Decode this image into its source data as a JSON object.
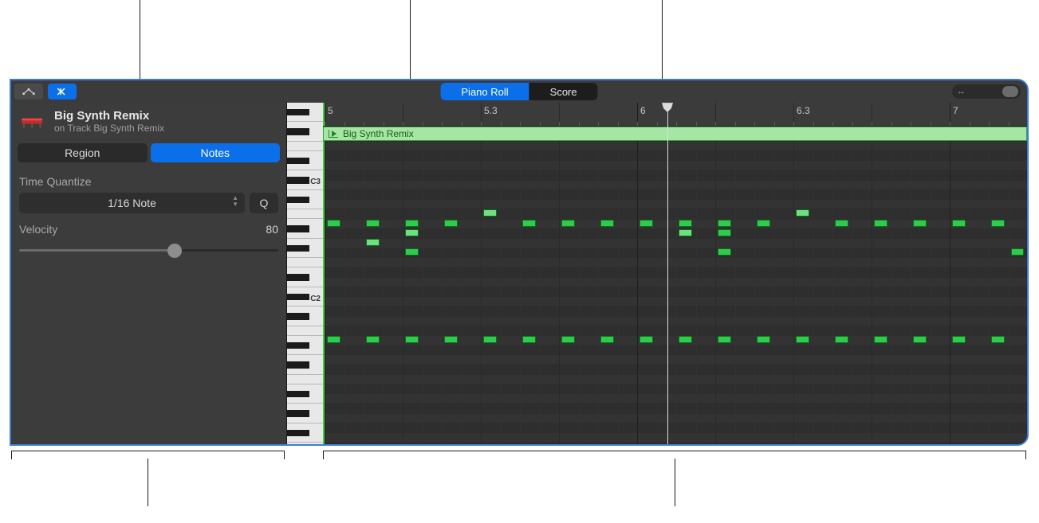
{
  "viewSwitcher": {
    "pianoRoll": "Piano Roll",
    "score": "Score"
  },
  "region": {
    "name": "Big Synth Remix",
    "subtitle": "on Track Big Synth Remix",
    "barLabel": "Big Synth Remix"
  },
  "inspectorTabs": {
    "region": "Region",
    "notes": "Notes"
  },
  "timeQuantize": {
    "label": "Time Quantize",
    "value": "1/16 Note",
    "qButton": "Q"
  },
  "velocity": {
    "label": "Velocity",
    "value": "80"
  },
  "ruler": {
    "ticks": [
      {
        "pos": 0,
        "label": "5",
        "maj": true
      },
      {
        "pos": 98,
        "label": ""
      },
      {
        "pos": 196,
        "label": "5.3"
      },
      {
        "pos": 294,
        "label": ""
      },
      {
        "pos": 392,
        "label": "6",
        "maj": true
      },
      {
        "pos": 490,
        "label": ""
      },
      {
        "pos": 588,
        "label": "6.3"
      },
      {
        "pos": 686,
        "label": ""
      },
      {
        "pos": 784,
        "label": "7",
        "maj": true
      }
    ]
  },
  "pianoKeys": {
    "labels": [
      {
        "text": "C3",
        "topPx": 94
      },
      {
        "text": "C2",
        "topPx": 241
      }
    ]
  },
  "playheadLeft": 432,
  "gridConfig": {
    "rowHeight": 12.2,
    "startTopOffset": 0,
    "beatWidth": 24.5,
    "barBeats": 16
  },
  "notes": [
    {
      "col": 0,
      "row": 8,
      "len": 1
    },
    {
      "col": 2,
      "row": 8,
      "len": 1
    },
    {
      "col": 4,
      "row": 8,
      "len": 1
    },
    {
      "col": 2,
      "row": 10,
      "len": 1,
      "light": true
    },
    {
      "col": 6,
      "row": 8,
      "len": 1
    },
    {
      "col": 8,
      "row": 7,
      "len": 1,
      "light": true
    },
    {
      "col": 10,
      "row": 8,
      "len": 1
    },
    {
      "col": 12,
      "row": 8,
      "len": 1
    },
    {
      "col": 14,
      "row": 8,
      "len": 1
    },
    {
      "col": 4,
      "row": 9,
      "len": 1,
      "light": true
    },
    {
      "col": 4,
      "row": 11,
      "len": 1,
      "light": false
    },
    {
      "col": 16,
      "row": 8,
      "len": 1
    },
    {
      "col": 18,
      "row": 8,
      "len": 1
    },
    {
      "col": 20,
      "row": 8,
      "len": 1
    },
    {
      "col": 22,
      "row": 8,
      "len": 1
    },
    {
      "col": 24,
      "row": 7,
      "len": 1,
      "light": true
    },
    {
      "col": 26,
      "row": 8,
      "len": 1
    },
    {
      "col": 28,
      "row": 8,
      "len": 1
    },
    {
      "col": 30,
      "row": 8,
      "len": 1
    },
    {
      "col": 32,
      "row": 8,
      "len": 1
    },
    {
      "col": 34,
      "row": 8,
      "len": 1
    },
    {
      "col": 18,
      "row": 9,
      "len": 1,
      "light": true
    },
    {
      "col": 20,
      "row": 9,
      "len": 1
    },
    {
      "col": 20,
      "row": 11,
      "len": 1
    },
    {
      "col": 35,
      "row": 11,
      "len": 1
    },
    {
      "col": 0,
      "row": 20,
      "len": 1
    },
    {
      "col": 2,
      "row": 20,
      "len": 1
    },
    {
      "col": 4,
      "row": 20,
      "len": 1
    },
    {
      "col": 6,
      "row": 20,
      "len": 1
    },
    {
      "col": 8,
      "row": 20,
      "len": 1
    },
    {
      "col": 10,
      "row": 20,
      "len": 1
    },
    {
      "col": 12,
      "row": 20,
      "len": 1
    },
    {
      "col": 14,
      "row": 20,
      "len": 1
    },
    {
      "col": 16,
      "row": 20,
      "len": 1
    },
    {
      "col": 18,
      "row": 20,
      "len": 1
    },
    {
      "col": 20,
      "row": 20,
      "len": 1
    },
    {
      "col": 22,
      "row": 20,
      "len": 1
    },
    {
      "col": 24,
      "row": 20,
      "len": 1
    },
    {
      "col": 26,
      "row": 20,
      "len": 1
    },
    {
      "col": 28,
      "row": 20,
      "len": 1
    },
    {
      "col": 30,
      "row": 20,
      "len": 1
    },
    {
      "col": 32,
      "row": 20,
      "len": 1
    },
    {
      "col": 34,
      "row": 20,
      "len": 1
    }
  ]
}
